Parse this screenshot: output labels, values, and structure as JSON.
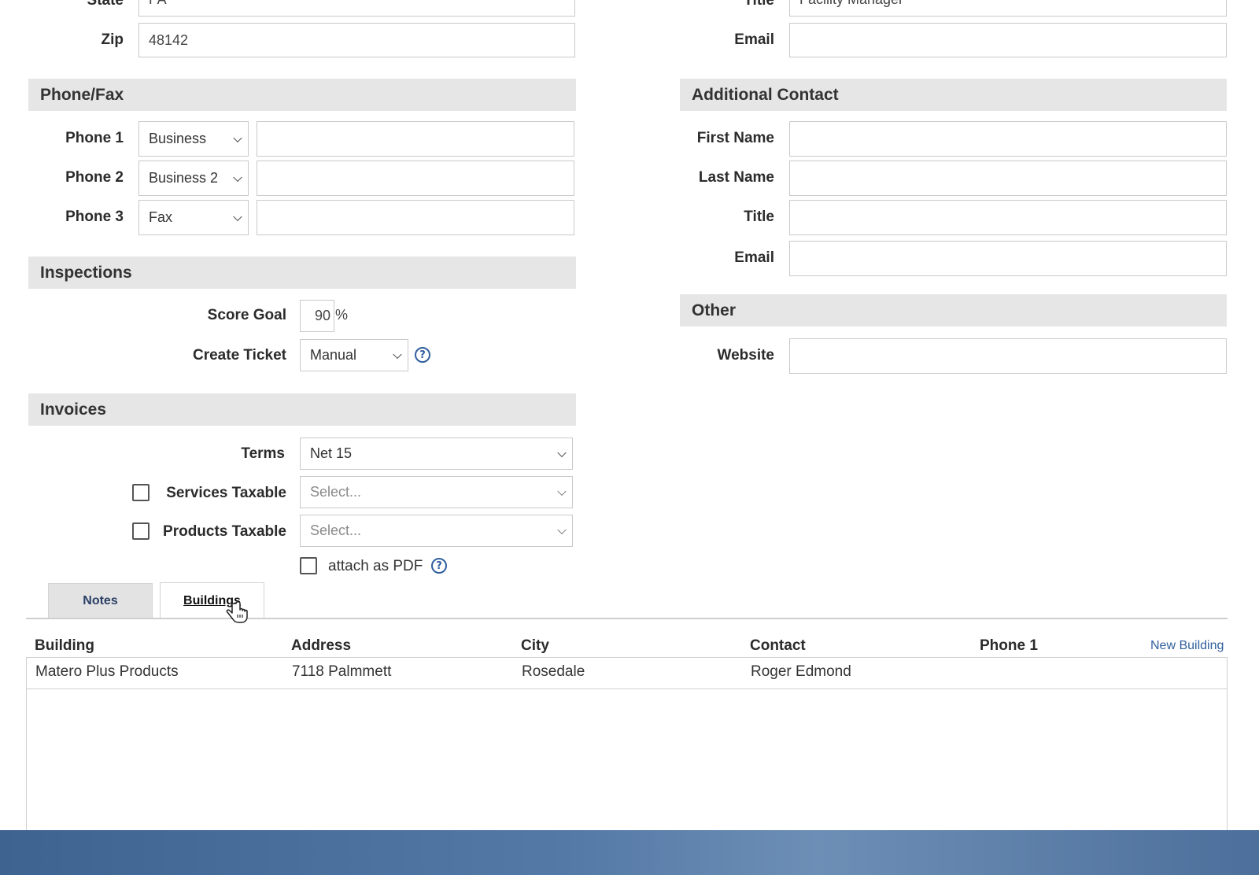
{
  "address": {
    "state_label": "State",
    "state_value": "PA",
    "zip_label": "Zip",
    "zip_value": "48142"
  },
  "primary_contact": {
    "title_label": "Title",
    "title_value": "Facility Manager",
    "email_label": "Email",
    "email_value": ""
  },
  "phone_fax": {
    "heading": "Phone/Fax",
    "rows": [
      {
        "label": "Phone 1",
        "type": "Business",
        "number": ""
      },
      {
        "label": "Phone 2",
        "type": "Business 2",
        "number": ""
      },
      {
        "label": "Phone 3",
        "type": "Fax",
        "number": ""
      }
    ]
  },
  "additional_contact": {
    "heading": "Additional Contact",
    "first_name_label": "First Name",
    "last_name_label": "Last Name",
    "title_label": "Title",
    "email_label": "Email"
  },
  "inspections": {
    "heading": "Inspections",
    "score_goal_label": "Score Goal",
    "score_goal_value": "90",
    "score_goal_unit": "%",
    "create_ticket_label": "Create Ticket",
    "create_ticket_value": "Manual"
  },
  "other": {
    "heading": "Other",
    "website_label": "Website",
    "website_value": ""
  },
  "invoices": {
    "heading": "Invoices",
    "terms_label": "Terms",
    "terms_value": "Net 15",
    "services_taxable_label": "Services Taxable",
    "services_taxable_placeholder": "Select...",
    "products_taxable_label": "Products Taxable",
    "products_taxable_placeholder": "Select...",
    "attach_pdf_label": "attach as PDF"
  },
  "tabs": [
    {
      "label": "Notes",
      "active": false
    },
    {
      "label": "Buildings",
      "active": true
    }
  ],
  "buildings_table": {
    "columns": [
      "Building",
      "Address",
      "City",
      "Contact",
      "Phone 1"
    ],
    "new_link": "New Building",
    "rows": [
      {
        "building": "Matero Plus Products",
        "address": "7118 Palmmett",
        "city": "Rosedale",
        "contact": "Roger Edmond",
        "phone1": ""
      }
    ]
  },
  "colors": {
    "section_bg": "#e6e6e6",
    "link": "#2f5f9e",
    "taskbar": "#4a6d9a"
  }
}
